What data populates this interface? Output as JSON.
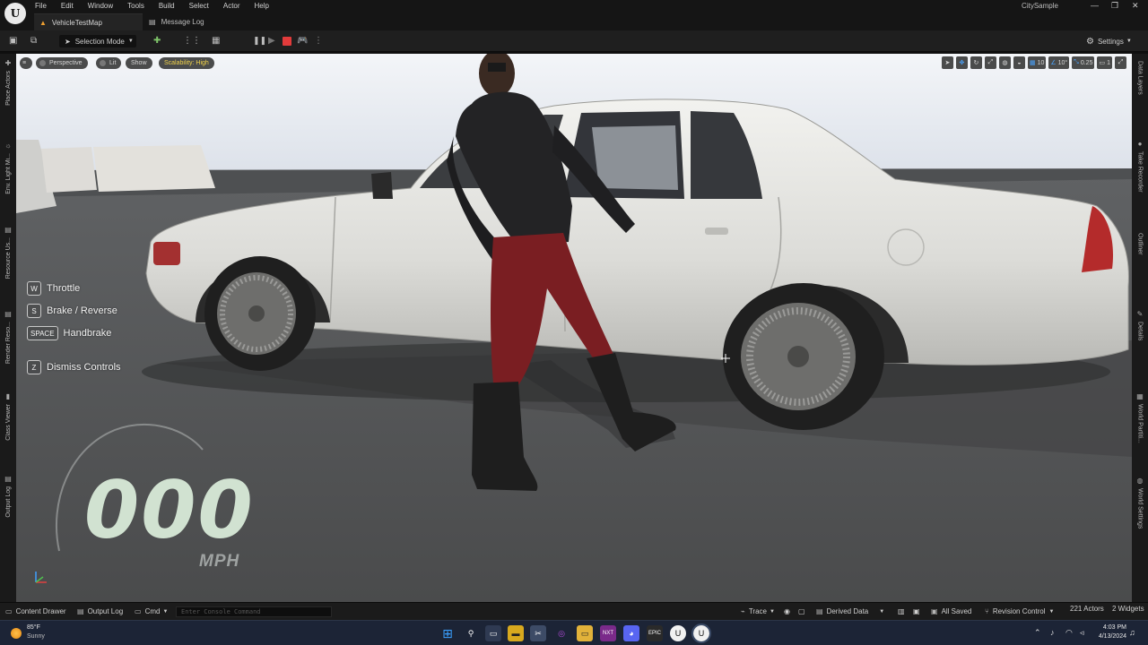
{
  "menu": [
    "File",
    "Edit",
    "Window",
    "Tools",
    "Build",
    "Select",
    "Actor",
    "Help"
  ],
  "project_name": "CitySample",
  "tabs": [
    {
      "label": "VehicleTestMap"
    },
    {
      "label": "Message Log"
    }
  ],
  "toolbar": {
    "selection_mode": "Selection Mode",
    "settings": "Settings"
  },
  "viewport": {
    "perspective": "Perspective",
    "lit": "Lit",
    "show": "Show",
    "scalability": "Scalability: High",
    "grid_snap": "10",
    "rotation_snap": "10°",
    "scale_snap": "0.25",
    "camera_speed": "1"
  },
  "controls": [
    {
      "key": "W",
      "label": "Throttle"
    },
    {
      "key": "S",
      "label": "Brake / Reverse"
    },
    {
      "key": "SPACE",
      "label": "Handbrake"
    },
    {
      "key": "Z",
      "label": "Dismiss Controls"
    }
  ],
  "speedometer": {
    "value": "000",
    "unit": "MPH"
  },
  "left_panels": [
    "Place Actors",
    "Env. Light Mi...",
    "Resource Us...",
    "Render Reso...",
    "Class Viewer",
    "Output Log"
  ],
  "right_panels": [
    "Data Layers",
    "Take Recorder",
    "Outliner",
    "Details",
    "World Partiti...",
    "World Settings"
  ],
  "statusbar": {
    "content_drawer": "Content Drawer",
    "output_log": "Output Log",
    "cmd": "Cmd",
    "console_placeholder": "Enter Console Command",
    "trace": "Trace",
    "derived_data": "Derived Data",
    "all_saved": "All Saved",
    "revision_control": "Revision Control",
    "actors": "221 Actors",
    "widgets": "2 Widgets"
  },
  "taskbar": {
    "temperature": "85°F",
    "weather": "Sunny",
    "time": "4:03 PM",
    "date": "4/13/2024"
  },
  "colors": {
    "accent_blue": "#4aa4ff",
    "scalability_yellow": "#f0d24a",
    "stop_red": "#e23b3b",
    "speed_green": "#dbeedb"
  }
}
